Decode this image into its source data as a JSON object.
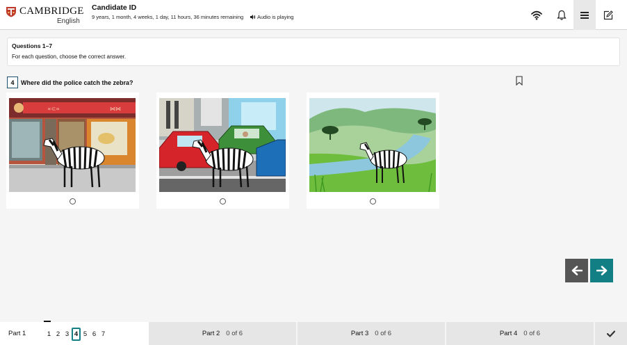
{
  "header": {
    "logo_main": "CAMBRIDGE",
    "logo_sub": "English",
    "candidate_title": "Candidate ID",
    "time_remaining": "9 years, 1 month, 4 weeks, 1 day, 11 hours, 36 minutes remaining",
    "audio_status": "Audio is playing"
  },
  "icons": {
    "wifi": "wifi-icon",
    "bell": "bell-icon",
    "menu": "menu-icon",
    "notes": "edit-note-icon"
  },
  "instructions": {
    "title": "Questions 1–7",
    "text": "For each question, choose the correct answer."
  },
  "question": {
    "number": "4",
    "text": "Where did the police catch the zebra?"
  },
  "options": [
    {
      "id": "A",
      "image": "zebra outside a restaurant"
    },
    {
      "id": "B",
      "image": "zebra next to parked cars"
    },
    {
      "id": "C",
      "image": "zebra by a river"
    }
  ],
  "colors": {
    "accent": "#127f85",
    "nav_prev": "#555555",
    "footer_inactive": "#e6e6e6"
  },
  "footer": {
    "part1_label": "Part 1",
    "question_numbers": [
      "1",
      "2",
      "3",
      "4",
      "5",
      "6",
      "7"
    ],
    "current_question": "4",
    "part2": {
      "label": "Part 2",
      "count": "0 of 6"
    },
    "part3": {
      "label": "Part 3",
      "count": "0 of 6"
    },
    "part4": {
      "label": "Part 4",
      "count": "0 of 6"
    }
  }
}
